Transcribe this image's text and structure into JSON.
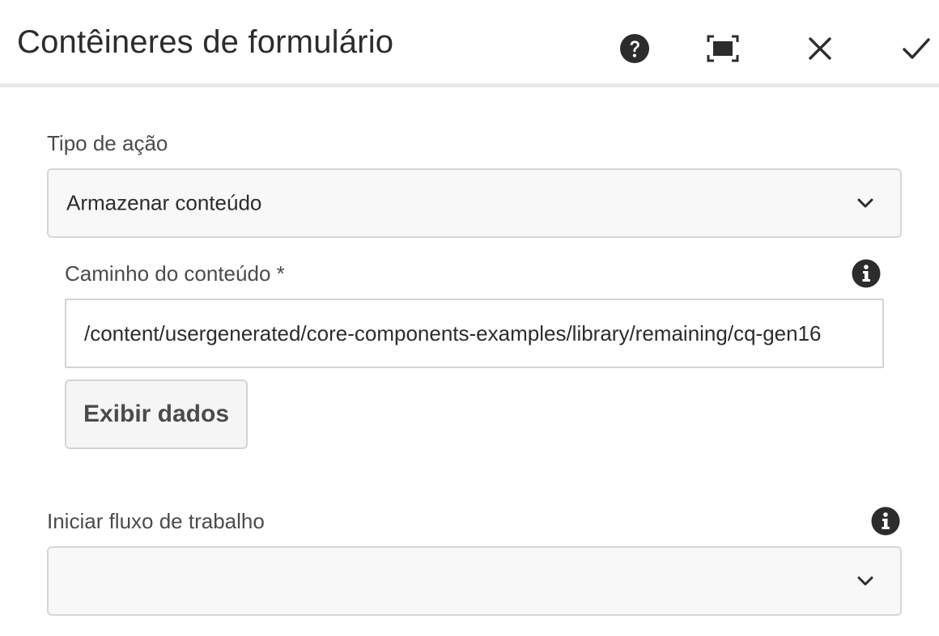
{
  "header": {
    "title": "Contêineres de formulário",
    "buttons": [
      {
        "name": "help",
        "icon": "help-icon"
      },
      {
        "name": "fullscreen",
        "icon": "fullscreen-icon"
      },
      {
        "name": "cancel",
        "icon": "close-icon"
      },
      {
        "name": "done",
        "icon": "checkmark-icon"
      }
    ]
  },
  "form": {
    "action_type": {
      "label": "Tipo de ação",
      "value": "Armazenar conteúdo"
    },
    "content_path": {
      "label": "Caminho do conteúdo *",
      "value": "/content/usergenerated/core-components-examples/library/remaining/cq-gen16",
      "info_icon": "info-icon"
    },
    "view_data_button": {
      "label": "Exibir dados"
    },
    "start_workflow": {
      "label": "Iniciar fluxo de trabalho",
      "value": "",
      "info_icon": "info-icon"
    }
  },
  "colors": {
    "text": "#2c2c2c",
    "label": "#4b4b4b",
    "field_background": "#f8f8f8",
    "border": "#d6d6d6",
    "icon": "#2c2c2c"
  }
}
